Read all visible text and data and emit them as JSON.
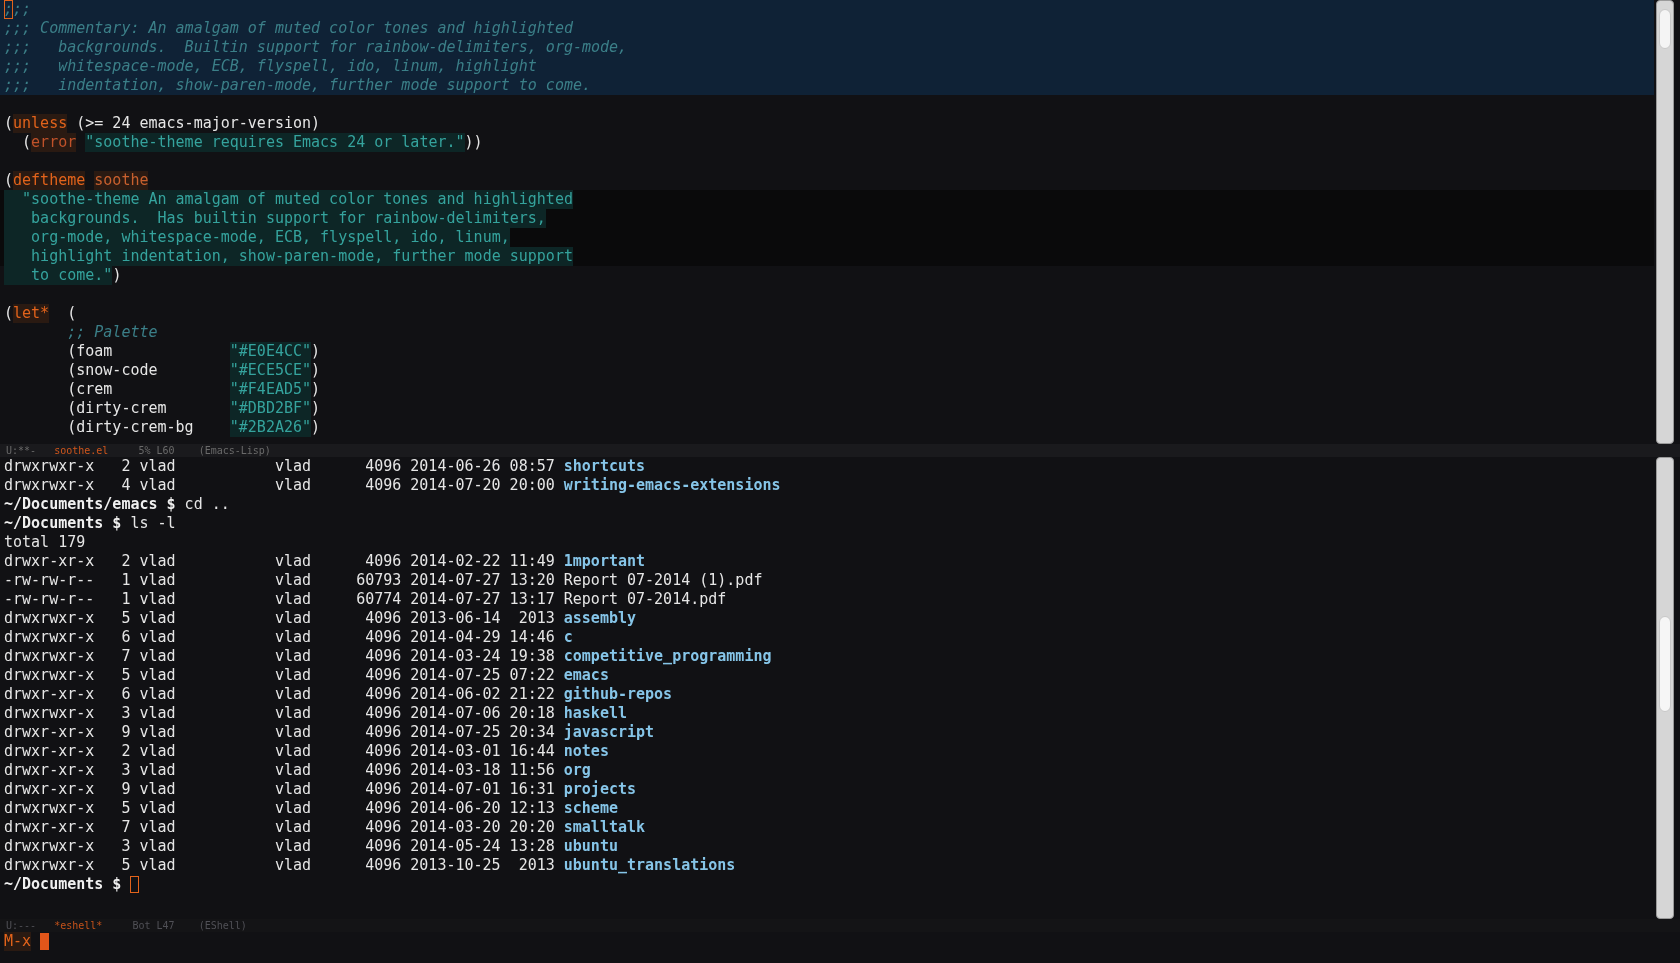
{
  "editor": {
    "lines": [
      {
        "kind": "comment",
        "segments": [
          {
            "text": ";",
            "kind": "comment",
            "cursor": true
          },
          {
            "text": ";;",
            "kind": "comment"
          }
        ]
      },
      {
        "kind": "comment",
        "segments": [
          {
            "text": ";;; Commentary: An amalgam of muted color tones and highlighted",
            "kind": "comment"
          }
        ]
      },
      {
        "kind": "comment",
        "segments": [
          {
            "text": ";;;   backgrounds.  Builtin support for rainbow-delimiters, org-mode,",
            "kind": "comment"
          }
        ]
      },
      {
        "kind": "comment",
        "segments": [
          {
            "text": ";;;   whitespace-mode, ECB, flyspell, ido, linum, highlight",
            "kind": "comment"
          }
        ]
      },
      {
        "kind": "comment",
        "segments": [
          {
            "text": ";;;   indentation, show-paren-mode, further mode support to come.",
            "kind": "comment"
          }
        ]
      },
      {
        "kind": "blank"
      },
      {
        "kind": "code",
        "segments": [
          {
            "text": "(",
            "kind": "plain"
          },
          {
            "text": "unless",
            "kind": "keyword"
          },
          {
            "text": " (>= 24 emacs-major-version)",
            "kind": "plain"
          }
        ]
      },
      {
        "kind": "code",
        "segments": [
          {
            "text": "  (",
            "kind": "plain"
          },
          {
            "text": "error",
            "kind": "builtin"
          },
          {
            "text": "\"soothe-theme requires Emacs 24 or later.\"",
            "kind": "string",
            "space_before": true
          },
          {
            "text": "))",
            "kind": "plain"
          }
        ]
      },
      {
        "kind": "blank"
      },
      {
        "kind": "code",
        "segments": [
          {
            "text": "(",
            "kind": "plain"
          },
          {
            "text": "deftheme",
            "kind": "keyword"
          },
          {
            "text": "soothe",
            "kind": "name",
            "space_before": true
          }
        ]
      },
      {
        "kind": "docstring",
        "segments": [
          {
            "text": "  \"soothe-theme An amalgam of muted color tones and highlighted",
            "kind": "string"
          }
        ]
      },
      {
        "kind": "docstring",
        "segments": [
          {
            "text": "   backgrounds.  Has builtin support for rainbow-delimiters,",
            "kind": "string"
          }
        ]
      },
      {
        "kind": "docstring",
        "segments": [
          {
            "text": "   org-mode, whitespace-mode, ECB, flyspell, ido, linum,",
            "kind": "string"
          }
        ]
      },
      {
        "kind": "docstring",
        "segments": [
          {
            "text": "   highlight indentation, show-paren-mode, further mode support",
            "kind": "string"
          }
        ]
      },
      {
        "kind": "code",
        "segments": [
          {
            "text": "   to come.\"",
            "kind": "string"
          },
          {
            "text": ")",
            "kind": "plain"
          }
        ]
      },
      {
        "kind": "blank"
      },
      {
        "kind": "code",
        "segments": [
          {
            "text": "(",
            "kind": "plain"
          },
          {
            "text": "let*",
            "kind": "keyword"
          },
          {
            "text": "  (",
            "kind": "plain"
          }
        ]
      },
      {
        "kind": "code",
        "segments": [
          {
            "text": "       ;; Palette",
            "kind": "comment"
          }
        ]
      },
      {
        "kind": "code",
        "segments": [
          {
            "text": "       (foam             ",
            "kind": "plain"
          },
          {
            "text": "\"#E0E4CC\"",
            "kind": "string"
          },
          {
            "text": ")",
            "kind": "plain"
          }
        ]
      },
      {
        "kind": "code",
        "segments": [
          {
            "text": "       (snow-code        ",
            "kind": "plain"
          },
          {
            "text": "\"#ECE5CE\"",
            "kind": "string"
          },
          {
            "text": ")",
            "kind": "plain"
          }
        ]
      },
      {
        "kind": "code",
        "segments": [
          {
            "text": "       (crem             ",
            "kind": "plain"
          },
          {
            "text": "\"#F4EAD5\"",
            "kind": "string"
          },
          {
            "text": ")",
            "kind": "plain"
          }
        ]
      },
      {
        "kind": "code",
        "segments": [
          {
            "text": "       (dirty-crem       ",
            "kind": "plain"
          },
          {
            "text": "\"#DBD2BF\"",
            "kind": "string"
          },
          {
            "text": ")",
            "kind": "plain"
          }
        ]
      },
      {
        "kind": "code",
        "segments": [
          {
            "text": "       (dirty-crem-bg    ",
            "kind": "plain"
          },
          {
            "text": "\"#2B2A26\"",
            "kind": "string"
          },
          {
            "text": ")",
            "kind": "plain"
          }
        ]
      }
    ],
    "mode_line": {
      "active": true,
      "state": "U:**-",
      "buffer": "soothe.el",
      "position": "5% L60",
      "mode": "(Emacs-Lisp)"
    }
  },
  "eshell": {
    "lines": [
      {
        "kind": "listing",
        "perms": "drwxrwxr-x",
        "links": "2",
        "owner": "vlad",
        "group": "vlad",
        "size": "4096",
        "date": "2014-06-26",
        "time": "08:57",
        "name": "shortcuts",
        "dir": true
      },
      {
        "kind": "listing",
        "perms": "drwxrwxr-x",
        "links": "4",
        "owner": "vlad",
        "group": "vlad",
        "size": "4096",
        "date": "2014-07-20",
        "time": "20:00",
        "name": "writing-emacs-extensions",
        "dir": true
      },
      {
        "kind": "prompt",
        "prompt": "~/Documents/emacs $",
        "command": "cd .."
      },
      {
        "kind": "prompt",
        "prompt": "~/Documents $",
        "command": "ls -l"
      },
      {
        "kind": "output",
        "text": "total 179"
      },
      {
        "kind": "listing",
        "perms": "drwxr-xr-x",
        "links": "2",
        "owner": "vlad",
        "group": "vlad",
        "size": "4096",
        "date": "2014-02-22",
        "time": "11:49",
        "name": "1mportant",
        "dir": true
      },
      {
        "kind": "listing",
        "perms": "-rw-rw-r--",
        "links": "1",
        "owner": "vlad",
        "group": "vlad",
        "size": "60793",
        "date": "2014-07-27",
        "time": "13:20",
        "name": "Report 07-2014 (1).pdf",
        "dir": false
      },
      {
        "kind": "listing",
        "perms": "-rw-rw-r--",
        "links": "1",
        "owner": "vlad",
        "group": "vlad",
        "size": "60774",
        "date": "2014-07-27",
        "time": "13:17",
        "name": "Report 07-2014.pdf",
        "dir": false
      },
      {
        "kind": "listing",
        "perms": "drwxrwxr-x",
        "links": "5",
        "owner": "vlad",
        "group": "vlad",
        "size": "4096",
        "date": "2013-06-14",
        "time": "2013",
        "name": "assembly",
        "dir": true
      },
      {
        "kind": "listing",
        "perms": "drwxrwxr-x",
        "links": "6",
        "owner": "vlad",
        "group": "vlad",
        "size": "4096",
        "date": "2014-04-29",
        "time": "14:46",
        "name": "c",
        "dir": true
      },
      {
        "kind": "listing",
        "perms": "drwxrwxr-x",
        "links": "7",
        "owner": "vlad",
        "group": "vlad",
        "size": "4096",
        "date": "2014-03-24",
        "time": "19:38",
        "name": "competitive_programming",
        "dir": true
      },
      {
        "kind": "listing",
        "perms": "drwxrwxr-x",
        "links": "5",
        "owner": "vlad",
        "group": "vlad",
        "size": "4096",
        "date": "2014-07-25",
        "time": "07:22",
        "name": "emacs",
        "dir": true
      },
      {
        "kind": "listing",
        "perms": "drwxr-xr-x",
        "links": "6",
        "owner": "vlad",
        "group": "vlad",
        "size": "4096",
        "date": "2014-06-02",
        "time": "21:22",
        "name": "github-repos",
        "dir": true
      },
      {
        "kind": "listing",
        "perms": "drwxrwxr-x",
        "links": "3",
        "owner": "vlad",
        "group": "vlad",
        "size": "4096",
        "date": "2014-07-06",
        "time": "20:18",
        "name": "haskell",
        "dir": true
      },
      {
        "kind": "listing",
        "perms": "drwxr-xr-x",
        "links": "9",
        "owner": "vlad",
        "group": "vlad",
        "size": "4096",
        "date": "2014-07-25",
        "time": "20:34",
        "name": "javascript",
        "dir": true
      },
      {
        "kind": "listing",
        "perms": "drwxr-xr-x",
        "links": "2",
        "owner": "vlad",
        "group": "vlad",
        "size": "4096",
        "date": "2014-03-01",
        "time": "16:44",
        "name": "notes",
        "dir": true
      },
      {
        "kind": "listing",
        "perms": "drwxr-xr-x",
        "links": "3",
        "owner": "vlad",
        "group": "vlad",
        "size": "4096",
        "date": "2014-03-18",
        "time": "11:56",
        "name": "org",
        "dir": true
      },
      {
        "kind": "listing",
        "perms": "drwxr-xr-x",
        "links": "9",
        "owner": "vlad",
        "group": "vlad",
        "size": "4096",
        "date": "2014-07-01",
        "time": "16:31",
        "name": "projects",
        "dir": true
      },
      {
        "kind": "listing",
        "perms": "drwxrwxr-x",
        "links": "5",
        "owner": "vlad",
        "group": "vlad",
        "size": "4096",
        "date": "2014-06-20",
        "time": "12:13",
        "name": "scheme",
        "dir": true
      },
      {
        "kind": "listing",
        "perms": "drwxr-xr-x",
        "links": "7",
        "owner": "vlad",
        "group": "vlad",
        "size": "4096",
        "date": "2014-03-20",
        "time": "20:20",
        "name": "smalltalk",
        "dir": true
      },
      {
        "kind": "listing",
        "perms": "drwxrwxr-x",
        "links": "3",
        "owner": "vlad",
        "group": "vlad",
        "size": "4096",
        "date": "2014-05-24",
        "time": "13:28",
        "name": "ubuntu",
        "dir": true
      },
      {
        "kind": "listing",
        "perms": "drwxrwxr-x",
        "links": "5",
        "owner": "vlad",
        "group": "vlad",
        "size": "4096",
        "date": "2013-10-25",
        "time": "2013",
        "name": "ubuntu_translations",
        "dir": true
      },
      {
        "kind": "prompt",
        "prompt": "~/Documents $",
        "cursor": true
      }
    ],
    "mode_line": {
      "active": false,
      "state": "U:---",
      "buffer": "*eshell*",
      "position": "Bot L47",
      "mode": "(EShell)"
    }
  },
  "minibuffer": {
    "text": "M-x",
    "cursor": true
  }
}
